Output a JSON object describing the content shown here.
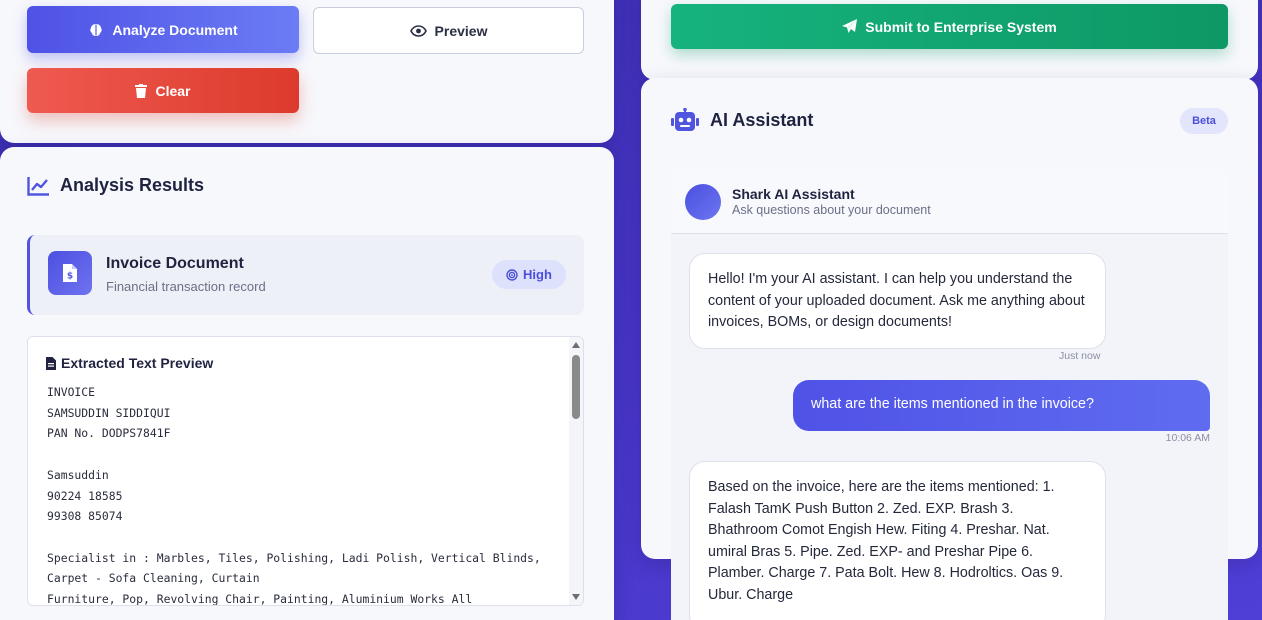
{
  "actions": {
    "analyze_label": "Analyze Document",
    "preview_label": "Preview",
    "clear_label": "Clear"
  },
  "results": {
    "title": "Analysis Results",
    "document": {
      "type": "Invoice Document",
      "description": "Financial transaction record",
      "confidence": "High"
    },
    "preview": {
      "title": "Extracted Text Preview",
      "text": "INVOICE\nSAMSUDDIN SIDDIQUI\nPAN No. DODPS7841F\n\nSamsuddin\n90224 18585\n99308 85074\n\nSpecialist in : Marbles, Tiles, Polishing, Ladi Polish, Vertical Blinds, Carpet - Sofa Cleaning, Curtain\nFurniture, Pop, Revolving Chair, Painting, Aluminium Works All"
    }
  },
  "submit": {
    "label": "Submit to Enterprise System"
  },
  "assistant": {
    "title": "AI Assistant",
    "badge": "Beta",
    "chat": {
      "name": "Shark AI Assistant",
      "subtitle": "Ask questions about your document",
      "messages": [
        {
          "role": "bot",
          "text": "Hello! I'm your AI assistant. I can help you understand the content of your uploaded document. Ask me anything about invoices, BOMs, or design documents!",
          "time": "Just now"
        },
        {
          "role": "user",
          "text": "what are the items mentioned in the invoice?",
          "time": "10:06 AM"
        },
        {
          "role": "bot",
          "text": "Based on the invoice, here are the items mentioned: 1. Falash TamK Push Button 2. Zed. EXP. Brash 3. Bhathroom Comot Engish Hew. Fiting 4. Preshar. Nat. umiral Bras 5. Pipe. Zed. EXP- and Preshar Pipe 6. Plamber. Charge 7. Pata Bolt. Hew 8. Hodroltics. Oas 9. Ubur. Charge",
          "time": ""
        }
      ]
    }
  },
  "colors": {
    "primary": "#4f52e6",
    "danger": "#dc3a2c",
    "success": "#0d9865",
    "background": "#4634c4"
  }
}
